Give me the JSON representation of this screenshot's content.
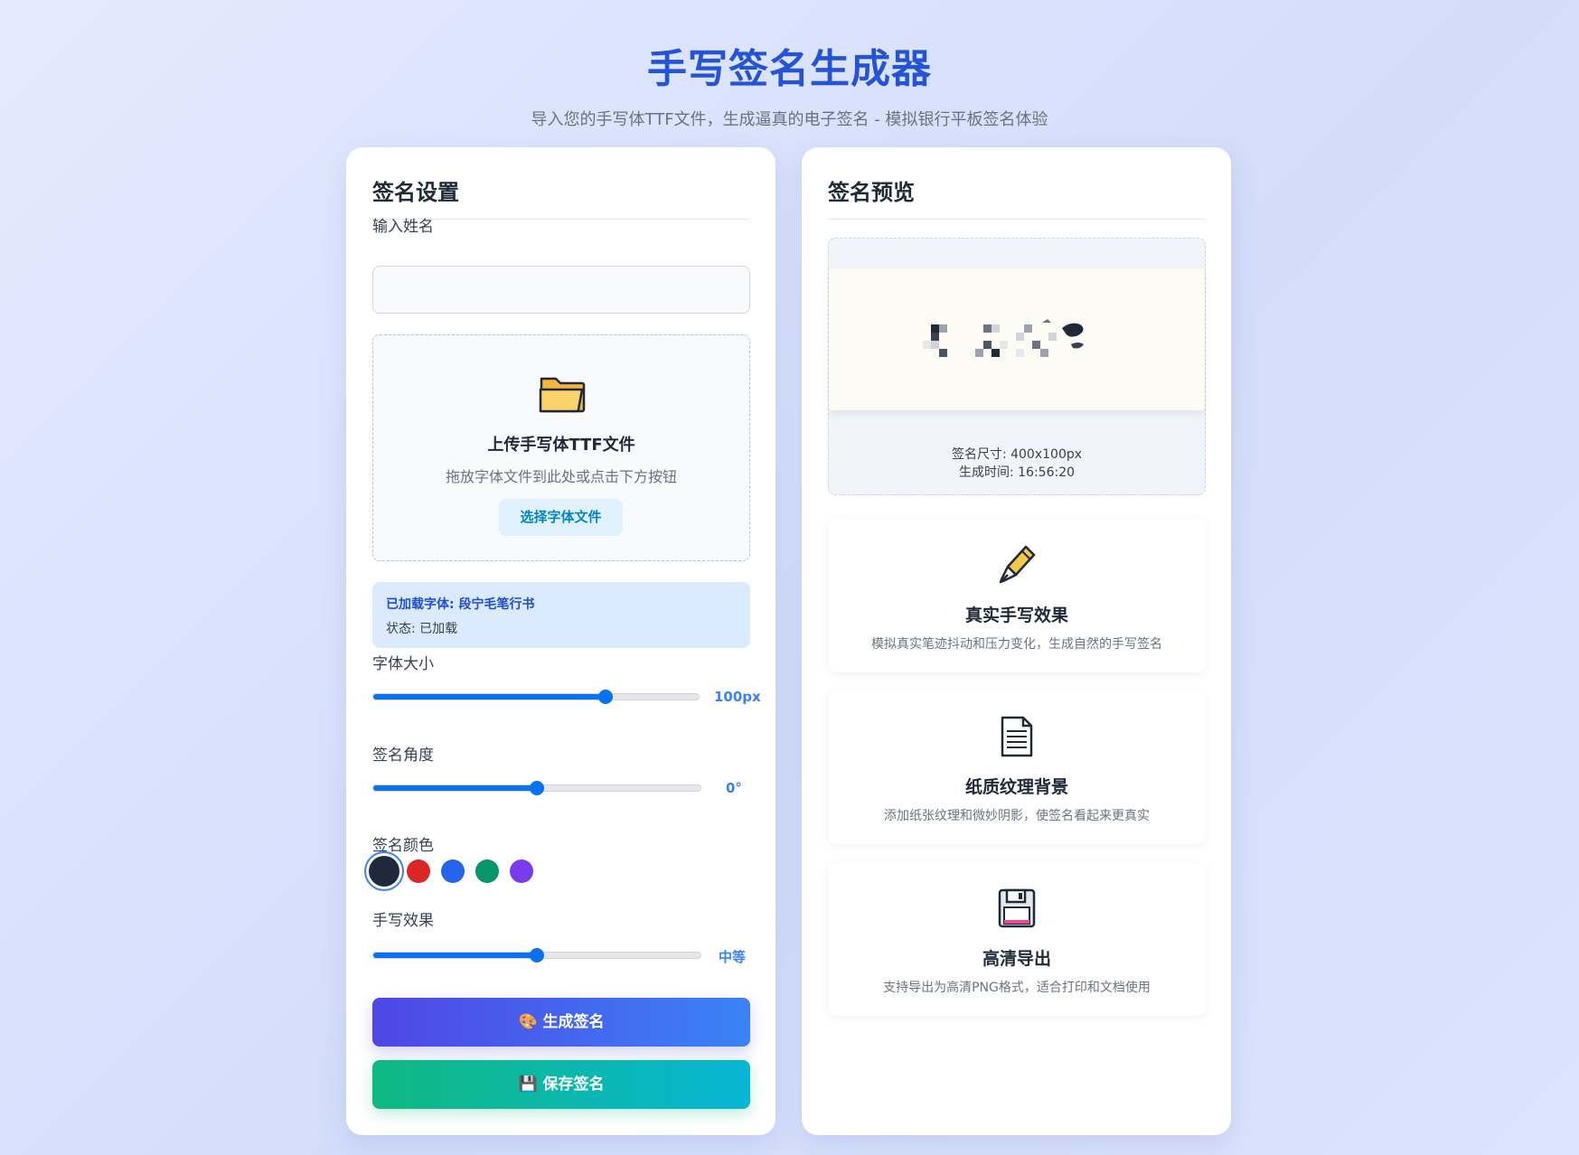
{
  "header": {
    "title": "手写签名生成器",
    "subtitle": "导入您的手写体TTF文件，生成逼真的电子签名 - 模拟银行平板签名体验"
  },
  "settings": {
    "title": "签名设置",
    "name_label": "输入姓名",
    "name_value": "",
    "upload": {
      "title": "上传手写体TTF文件",
      "hint": "拖放字体文件到此处或点击下方按钮",
      "button": "选择字体文件"
    },
    "font_info": {
      "loaded": "已加载字体: 段宁毛笔行书",
      "status": "状态: 已加载"
    },
    "font_size": {
      "label": "字体大小",
      "value": "100px",
      "fraction": 0.715
    },
    "angle": {
      "label": "签名角度",
      "value": "0°",
      "fraction": 0.5
    },
    "color": {
      "label": "签名颜色",
      "options": [
        "#1e293b",
        "#dc2626",
        "#2563eb",
        "#059669",
        "#7c3aed"
      ],
      "selected": "#1e293b"
    },
    "effect": {
      "label": "手写效果",
      "value": "中等",
      "fraction": 0.5
    },
    "generate_button": "🎨 生成签名",
    "save_button": "💾 保存签名"
  },
  "preview": {
    "title": "签名预览",
    "size_text": "签名尺寸: 400x100px",
    "time_text": "生成时间: 16:56:20"
  },
  "features": [
    {
      "icon": "fountain-pen-icon",
      "title": "真实手写效果",
      "desc": "模拟真实笔迹抖动和压力变化，生成自然的手写签名"
    },
    {
      "icon": "document-icon",
      "title": "纸质纹理背景",
      "desc": "添加纸张纹理和微妙阴影，使签名看起来更真实"
    },
    {
      "icon": "floppy-disk-icon",
      "title": "高清导出",
      "desc": "支持导出为高清PNG格式，适合打印和文档使用"
    }
  ]
}
